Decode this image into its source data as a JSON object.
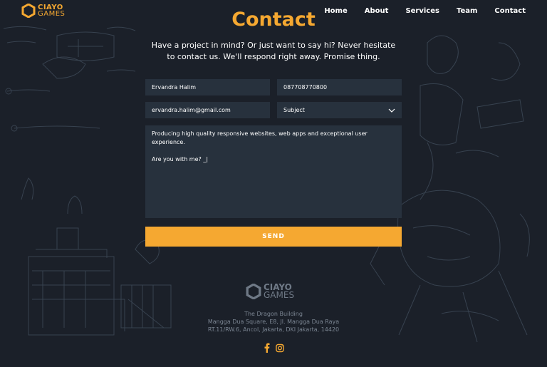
{
  "brand": {
    "line1": "CIAYO",
    "line2": "GAMES",
    "accent": "#f5a831"
  },
  "nav": [
    "Home",
    "About",
    "Services",
    "Team",
    "Contact"
  ],
  "page": {
    "title": "Contact",
    "intro_line1": "Have a project in mind? Or just want to say hi? Never hesitate",
    "intro_line2": "to contact us. We'll respond right away. Promise thing."
  },
  "form": {
    "name": "Ervandra Halim",
    "phone": "087708770800",
    "email": "ervandra.halim@gmail.com",
    "subject": "Subject",
    "message": "Producing high quality responsive websites, web apps and exceptional user experience.\n\nAre you with me? _|",
    "send_label": "SEND"
  },
  "footer": {
    "logo_line1": "CIAYO",
    "logo_line2": "GAMES",
    "addr1": "The Dragon Building",
    "addr2": "Mangga Dua Square, E8, Jl. Mangga Dua Raya",
    "addr3": "RT.11/RW.6, Ancol, Jakarta, DKI Jakarta, 14420",
    "social": [
      "facebook-icon",
      "instagram-icon"
    ]
  }
}
